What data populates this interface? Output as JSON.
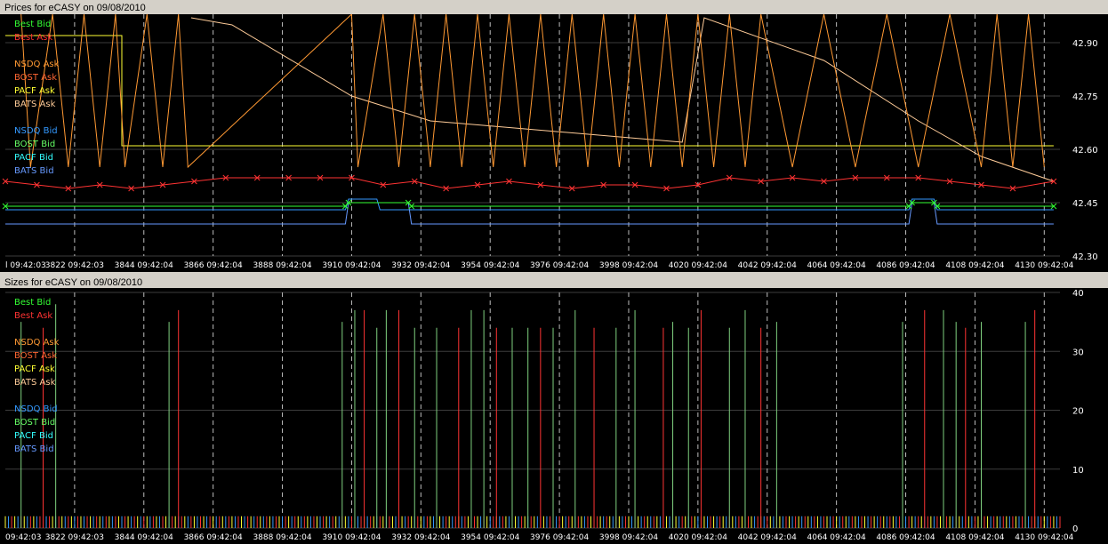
{
  "colors": {
    "best_bid": "#33ff33",
    "best_ask": "#ff3333",
    "nsdq_ask": "#ff9933",
    "bost_ask": "#ff6633",
    "pacf_ask": "#ffff33",
    "bats_ask": "#ffcc99",
    "nsdq_bid": "#3399ff",
    "bost_bid": "#66ff66",
    "pacf_bid": "#33ffff",
    "bats_bid": "#6699ff",
    "grid": "#3c3c3c",
    "vgrid": "#bdbdbd",
    "plot_bg": "#000000",
    "size_bar": "#7fd07f"
  },
  "chart_data": [
    {
      "type": "line",
      "title": "Prices for  eCASY  on  09/08/2010",
      "legend_placement": "top-left",
      "legend": [
        "Best Bid",
        "Best Ask",
        "",
        "NSDQ Ask",
        "BOST Ask",
        "PACF Ask",
        "BATS Ask",
        "",
        "NSDQ Bid",
        "BOST Bid",
        "PACF Bid",
        "BATS Bid"
      ],
      "legend_colors": [
        "best_bid",
        "best_ask",
        "",
        "nsdq_ask",
        "bost_ask",
        "pacf_ask",
        "bats_ask",
        "",
        "nsdq_bid",
        "bost_bid",
        "pacf_bid",
        "bats_bid"
      ],
      "ylim": [
        42.3,
        42.98
      ],
      "yticks": [
        "42.30",
        "42.45",
        "42.60",
        "42.75",
        "42.90"
      ],
      "ytick_values": [
        42.3,
        42.45,
        42.6,
        42.75,
        42.9
      ],
      "xlim": [
        3800,
        4135
      ],
      "xticks": [
        "l 09:42:03",
        "3822 09:42:03",
        "3844 09:42:04",
        "3866 09:42:04",
        "3888 09:42:04",
        "3910 09:42:04",
        "3932 09:42:04",
        "3954 09:42:04",
        "3976 09:42:04",
        "3998 09:42:04",
        "4020 09:42:04",
        "4042 09:42:04",
        "4064 09:42:04",
        "4086 09:42:04",
        "4108 09:42:04",
        "4130 09:42:04"
      ],
      "xtick_values": [
        3800,
        3822,
        3844,
        3866,
        3888,
        3910,
        3932,
        3954,
        3976,
        3998,
        4020,
        4042,
        4064,
        4086,
        4108,
        4130
      ],
      "grid": true,
      "series": [
        {
          "key": "pacf_ask",
          "x": [
            3800,
            3837,
            3837,
            3860,
            3860,
            3930,
            3930,
            4032,
            4032,
            4133
          ],
          "y": [
            42.92,
            42.92,
            42.61,
            42.61,
            42.61,
            42.61,
            42.61,
            42.61,
            42.61,
            42.61
          ]
        },
        {
          "key": "bats_ask",
          "x": [
            3859,
            3872,
            3910,
            3935,
            4015,
            4022,
            4060,
            4090,
            4110,
            4133
          ],
          "y": [
            42.97,
            42.95,
            42.75,
            42.68,
            42.62,
            42.97,
            42.85,
            42.68,
            42.58,
            42.51
          ]
        },
        {
          "key": "nsdq_ask",
          "x": [
            3805,
            3808,
            3815,
            3820,
            3825,
            3830,
            3835,
            3838,
            3845,
            3850,
            3855,
            3858,
            3910,
            3912,
            3920,
            3925,
            3930,
            3935,
            3940,
            3945,
            3950,
            3955,
            3960,
            3965,
            3970,
            3975,
            3980,
            3985,
            3990,
            3995,
            4000,
            4005,
            4010,
            4015,
            4020,
            4025,
            4030,
            4035,
            4040,
            4050,
            4060,
            4070,
            4080,
            4090,
            4100,
            4110,
            4115,
            4120,
            4125,
            4130
          ],
          "y": [
            42.98,
            42.55,
            42.98,
            42.55,
            42.98,
            42.55,
            42.98,
            42.55,
            42.98,
            42.55,
            42.98,
            42.55,
            42.98,
            42.55,
            42.98,
            42.55,
            42.98,
            42.55,
            42.98,
            42.55,
            42.98,
            42.55,
            42.98,
            42.55,
            42.98,
            42.55,
            42.98,
            42.55,
            42.98,
            42.55,
            42.98,
            42.55,
            42.98,
            42.55,
            42.98,
            42.55,
            42.98,
            42.55,
            42.98,
            42.55,
            42.98,
            42.55,
            42.98,
            42.55,
            42.98,
            42.55,
            42.98,
            42.55,
            42.98,
            42.55
          ]
        },
        {
          "key": "best_ask",
          "x": [
            3800,
            3810,
            3820,
            3830,
            3840,
            3850,
            3860,
            3870,
            3880,
            3890,
            3900,
            3910,
            3920,
            3930,
            3940,
            3950,
            3960,
            3970,
            3980,
            3990,
            4000,
            4010,
            4020,
            4030,
            4040,
            4050,
            4060,
            4070,
            4080,
            4090,
            4100,
            4110,
            4120,
            4133
          ],
          "y": [
            42.51,
            42.5,
            42.49,
            42.5,
            42.49,
            42.5,
            42.51,
            42.52,
            42.52,
            42.52,
            42.52,
            42.52,
            42.5,
            42.51,
            42.49,
            42.5,
            42.51,
            42.5,
            42.49,
            42.5,
            42.5,
            42.49,
            42.5,
            42.52,
            42.51,
            42.52,
            42.51,
            42.52,
            42.52,
            42.52,
            42.51,
            42.5,
            42.49,
            42.51
          ]
        },
        {
          "key": "nsdq_bid",
          "x": [
            3800,
            3908,
            3909,
            3918,
            3919,
            4087,
            4088,
            4095,
            4096,
            4133
          ],
          "y": [
            42.43,
            42.43,
            42.46,
            42.46,
            42.43,
            42.43,
            42.46,
            42.46,
            42.43,
            42.43
          ]
        },
        {
          "key": "bats_bid",
          "x": [
            3800,
            3908,
            3909,
            3928,
            3929,
            4087,
            4088,
            4095,
            4096,
            4133
          ],
          "y": [
            42.39,
            42.39,
            42.45,
            42.45,
            42.39,
            42.39,
            42.45,
            42.45,
            42.39,
            42.39
          ]
        },
        {
          "key": "best_bid",
          "x": [
            3800,
            3908,
            3909,
            3928,
            3929,
            4087,
            4088,
            4095,
            4096,
            4133
          ],
          "y": [
            42.44,
            42.44,
            42.45,
            42.45,
            42.44,
            42.44,
            42.45,
            42.45,
            42.44,
            42.44
          ]
        }
      ]
    },
    {
      "type": "bar",
      "title": "Sizes for  eCASY  on  09/08/2010",
      "legend_placement": "top-left",
      "legend": [
        "Best Bid",
        "Best Ask",
        "",
        "NSDQ Ask",
        "BOST Ask",
        "PACF Ask",
        "BATS Ask",
        "",
        "NSDQ Bid",
        "BOST Bid",
        "PACF Bid",
        "BATS Bid"
      ],
      "legend_colors": [
        "best_bid",
        "best_ask",
        "",
        "nsdq_ask",
        "bost_ask",
        "pacf_ask",
        "bats_ask",
        "",
        "nsdq_bid",
        "bost_bid",
        "pacf_bid",
        "bats_bid"
      ],
      "ylim": [
        0,
        40
      ],
      "yticks": [
        "0",
        "10",
        "20",
        "30",
        "40"
      ],
      "ytick_values": [
        0,
        10,
        20,
        30,
        40
      ],
      "xlim": [
        3800,
        4135
      ],
      "xticks": [
        "09:42:03",
        "3822 09:42:03",
        "3844 09:42:04",
        "3866 09:42:04",
        "3888 09:42:04",
        "3910 09:42:04",
        "3932 09:42:04",
        "3954 09:42:04",
        "3976 09:42:04",
        "3998 09:42:04",
        "4020 09:42:04",
        "4042 09:42:04",
        "4064 09:42:04",
        "4086 09:42:04",
        "4108 09:42:04",
        "4130 09:42:04"
      ],
      "xtick_values": [
        3800,
        3822,
        3844,
        3866,
        3888,
        3910,
        3932,
        3954,
        3976,
        3998,
        4020,
        4042,
        4064,
        4086,
        4108,
        4130
      ],
      "grid": true,
      "bars": {
        "x": [
          3805,
          3812,
          3816,
          3852,
          3855,
          3907,
          3911,
          3914,
          3918,
          3921,
          3925,
          3930,
          3937,
          3944,
          3948,
          3952,
          3956,
          3961,
          3966,
          3970,
          3974,
          3981,
          3987,
          3994,
          4000,
          4009,
          4012,
          4017,
          4021,
          4030,
          4035,
          4040,
          4045,
          4085,
          4092,
          4098,
          4102,
          4105,
          4110,
          4124,
          4127
        ],
        "y": [
          35,
          34,
          38,
          35,
          37,
          35,
          37,
          37,
          34,
          37,
          37,
          34,
          34,
          34,
          37,
          37,
          34,
          34,
          34,
          34,
          34,
          37,
          34,
          34,
          37,
          34,
          35,
          34,
          37,
          34,
          37,
          34,
          35,
          35,
          37,
          37,
          35,
          34,
          35,
          35,
          37
        ]
      },
      "small_bars": {
        "y": 2
      }
    }
  ]
}
